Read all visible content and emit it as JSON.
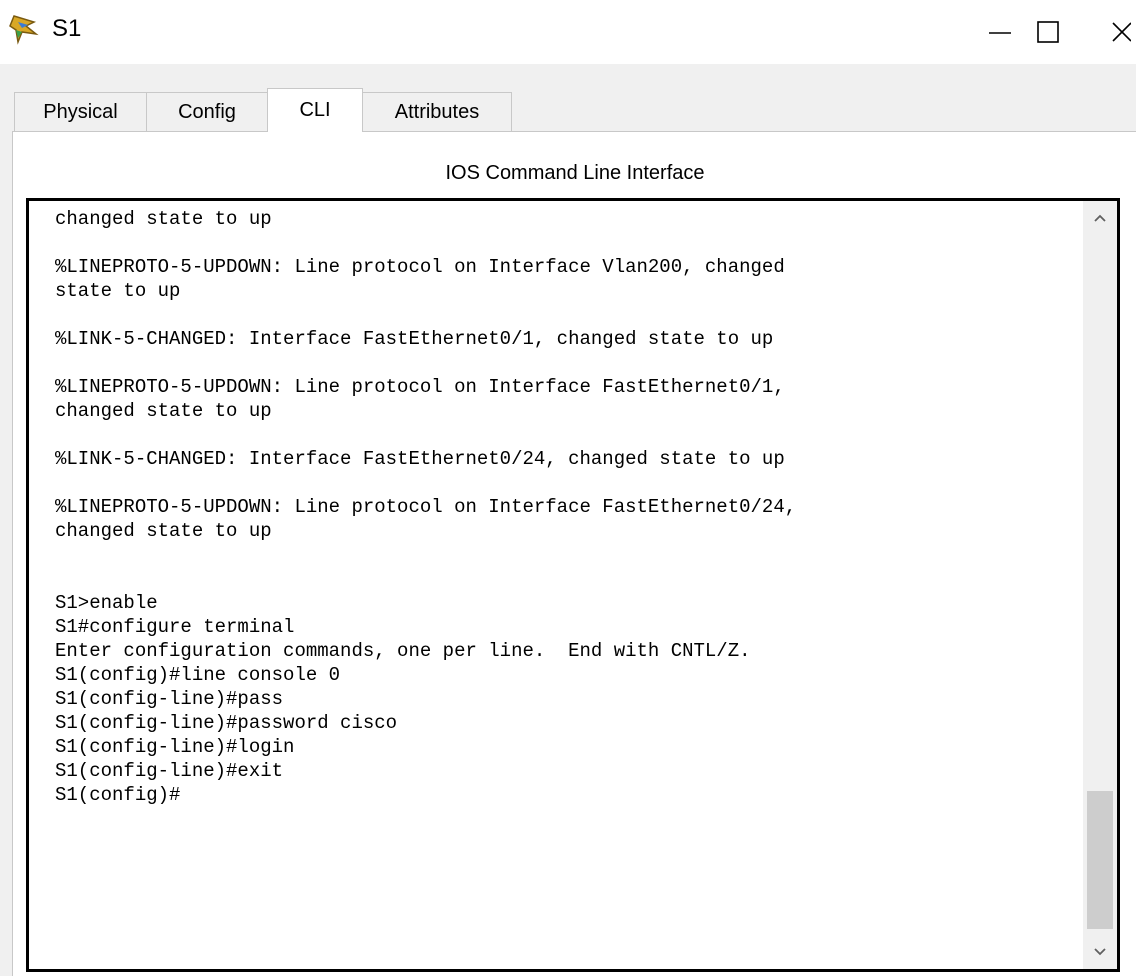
{
  "window": {
    "title": "S1",
    "icon": "switch-app-icon",
    "controls": [
      "minimize-icon",
      "maximize-icon",
      "close-icon"
    ]
  },
  "tabs": [
    {
      "label": "Physical",
      "active": false
    },
    {
      "label": "Config",
      "active": false
    },
    {
      "label": "CLI",
      "active": true
    },
    {
      "label": "Attributes",
      "active": false
    }
  ],
  "cli": {
    "heading": "IOS Command Line Interface",
    "lines": [
      "changed state to up",
      "",
      "%LINEPROTO-5-UPDOWN: Line protocol on Interface Vlan200, changed",
      "state to up",
      "",
      "%LINK-5-CHANGED: Interface FastEthernet0/1, changed state to up",
      "",
      "%LINEPROTO-5-UPDOWN: Line protocol on Interface FastEthernet0/1,",
      "changed state to up",
      "",
      "%LINK-5-CHANGED: Interface FastEthernet0/24, changed state to up",
      "",
      "%LINEPROTO-5-UPDOWN: Line protocol on Interface FastEthernet0/24,",
      "changed state to up",
      "",
      "",
      "S1>enable",
      "S1#configure terminal",
      "Enter configuration commands, one per line.  End with CNTL/Z.",
      "S1(config)#line console 0",
      "S1(config-line)#pass",
      "S1(config-line)#password cisco",
      "S1(config-line)#login",
      "S1(config-line)#exit",
      "S1(config)#"
    ]
  }
}
